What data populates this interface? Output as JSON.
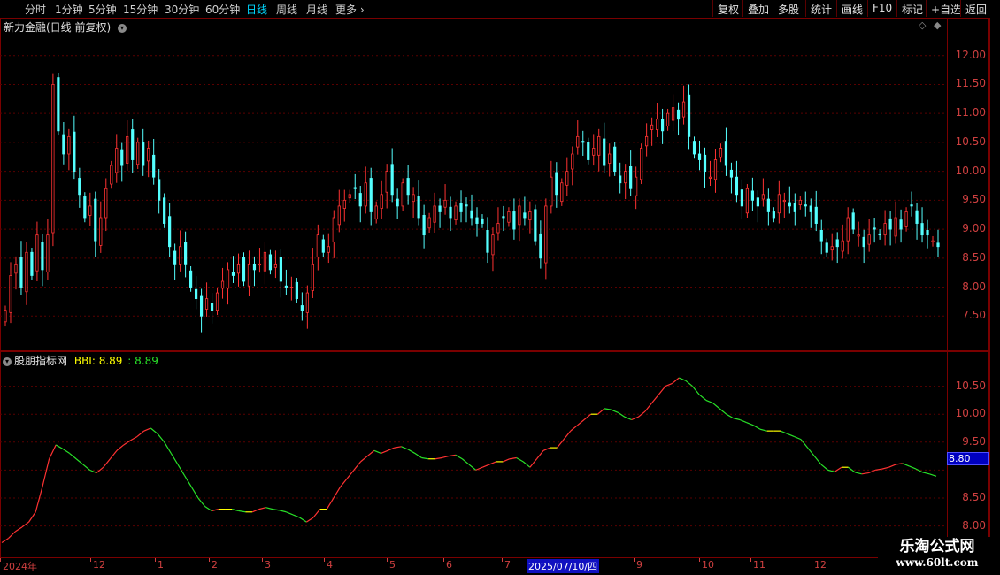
{
  "toolbar": {
    "periods": [
      "分时",
      "1分钟",
      "5分钟",
      "15分钟",
      "30分钟",
      "60分钟",
      "日线",
      "周线",
      "月线",
      "更多"
    ],
    "active_index": 6,
    "right_buttons": [
      "复权",
      "叠加",
      "多股",
      "统计",
      "画线",
      "F10",
      "标记",
      "+自选",
      "返回"
    ]
  },
  "main_pane": {
    "title": "新力金融(日线 前复权)",
    "y_ticks": [
      "12.00",
      "11.50",
      "11.00",
      "10.50",
      "10.00",
      "9.50",
      "9.00",
      "8.50",
      "8.00",
      "7.50"
    ]
  },
  "indicator_pane": {
    "name": "股朋指标网",
    "bbi_label": "BBI: 8.89",
    "bbi_value": ": 8.89",
    "y_ticks": [
      "10.50",
      "10.00",
      "9.50",
      "",
      "8.50",
      "8.00"
    ],
    "current_value": "8.80"
  },
  "x_axis": {
    "labels": [
      "2024年",
      "12",
      "1",
      "2",
      "3",
      "4",
      "5",
      "6",
      "7",
      "2025/07/10/四",
      "9",
      "10",
      "11",
      "12"
    ],
    "highlight": "2025/07/10/四"
  },
  "watermark": {
    "line1": "乐淘公式网",
    "line2": "www.60lt.com"
  },
  "colors": {
    "up": "#ff3232",
    "down": "#54ffff",
    "bbi_up": "#ff3232",
    "bbi_down": "#28e028",
    "bbi_flat": "#ffff00",
    "grid": "#5a0000"
  },
  "chart_data": [
    {
      "type": "candlestick",
      "ylim": [
        7.0,
        12.5
      ],
      "close": [
        7.6,
        8.2,
        8.4,
        8.0,
        8.6,
        8.2,
        8.9,
        8.3,
        8.9,
        11.5,
        10.7,
        10.3,
        10.6,
        10.0,
        9.6,
        9.2,
        9.4,
        8.8,
        9.2,
        9.7,
        10.1,
        10.4,
        10.1,
        10.6,
        10.2,
        10.5,
        10.1,
        10.4,
        9.9,
        9.5,
        9.1,
        8.7,
        8.4,
        8.7,
        8.4,
        8.0,
        7.8,
        7.5,
        7.8,
        7.6,
        7.9,
        8.1,
        8.3,
        8.2,
        8.4,
        8.1,
        8.4,
        8.3,
        8.4,
        8.6,
        8.3,
        8.4,
        8.1,
        8.0,
        8.0,
        7.8,
        7.6,
        7.9,
        8.4,
        8.9,
        8.6,
        8.7,
        9.2,
        9.4,
        9.5,
        9.6,
        9.7,
        9.4,
        9.8,
        9.3,
        9.4,
        9.6,
        10.0,
        9.6,
        9.4,
        9.8,
        9.6,
        9.6,
        9.2,
        8.9,
        9.2,
        9.4,
        9.3,
        9.5,
        9.2,
        9.4,
        9.3,
        9.4,
        9.2,
        9.1,
        9.1,
        8.6,
        8.9,
        9.1,
        9.2,
        9.3,
        9.0,
        9.4,
        9.2,
        9.3,
        8.8,
        8.5,
        9.4,
        9.9,
        9.6,
        9.8,
        10.0,
        10.3,
        10.6,
        10.5,
        10.2,
        10.4,
        10.6,
        10.1,
        10.3,
        10.0,
        9.8,
        10.0,
        9.7,
        9.9,
        10.4,
        10.6,
        10.8,
        10.9,
        10.7,
        11.0,
        11.1,
        10.9,
        11.2,
        10.6,
        10.3,
        10.2,
        10.0,
        9.9,
        10.2,
        10.4,
        10.1,
        9.9,
        9.6,
        9.4,
        9.7,
        9.5,
        9.4,
        9.6,
        9.3,
        9.2,
        9.6,
        9.5,
        9.4,
        9.3,
        9.5,
        9.4,
        9.3,
        9.1,
        8.8,
        8.6,
        8.7,
        8.7,
        8.8,
        9.2,
        9.0,
        8.9,
        8.7,
        8.9,
        9.0,
        8.9,
        9.1,
        9.0,
        9.2,
        9.0,
        9.3,
        9.4,
        9.1,
        8.9,
        8.9,
        8.8,
        8.7
      ]
    },
    {
      "type": "line",
      "name": "BBI",
      "ylim": [
        7.55,
        11.0
      ],
      "values": [
        7.7,
        7.78,
        7.9,
        7.98,
        8.07,
        8.25,
        8.7,
        9.2,
        9.45,
        9.38,
        9.3,
        9.2,
        9.1,
        9.0,
        8.95,
        9.05,
        9.2,
        9.35,
        9.45,
        9.53,
        9.6,
        9.7,
        9.75,
        9.65,
        9.5,
        9.3,
        9.1,
        8.9,
        8.7,
        8.5,
        8.35,
        8.27,
        8.3,
        8.3,
        8.3,
        8.27,
        8.25,
        8.25,
        8.3,
        8.33,
        8.3,
        8.28,
        8.25,
        8.2,
        8.15,
        8.07,
        8.15,
        8.3,
        8.3,
        8.5,
        8.7,
        8.85,
        9.0,
        9.15,
        9.25,
        9.35,
        9.3,
        9.35,
        9.4,
        9.42,
        9.37,
        9.3,
        9.22,
        9.2,
        9.2,
        9.22,
        9.25,
        9.27,
        9.2,
        9.1,
        9.0,
        9.05,
        9.1,
        9.15,
        9.15,
        9.2,
        9.22,
        9.15,
        9.05,
        9.2,
        9.35,
        9.4,
        9.4,
        9.55,
        9.7,
        9.8,
        9.9,
        10.0,
        10.0,
        10.1,
        10.08,
        10.03,
        9.95,
        9.9,
        9.95,
        10.05,
        10.2,
        10.35,
        10.5,
        10.55,
        10.65,
        10.6,
        10.5,
        10.35,
        10.25,
        10.2,
        10.1,
        10.0,
        9.93,
        9.9,
        9.85,
        9.8,
        9.73,
        9.7,
        9.7,
        9.7,
        9.65,
        9.6,
        9.55,
        9.4,
        9.25,
        9.1,
        9.0,
        8.97,
        9.05,
        9.05,
        8.96,
        8.93,
        8.95,
        9.0,
        9.02,
        9.05,
        9.1,
        9.12,
        9.07,
        9.02,
        8.96,
        8.93,
        8.89
      ]
    }
  ]
}
